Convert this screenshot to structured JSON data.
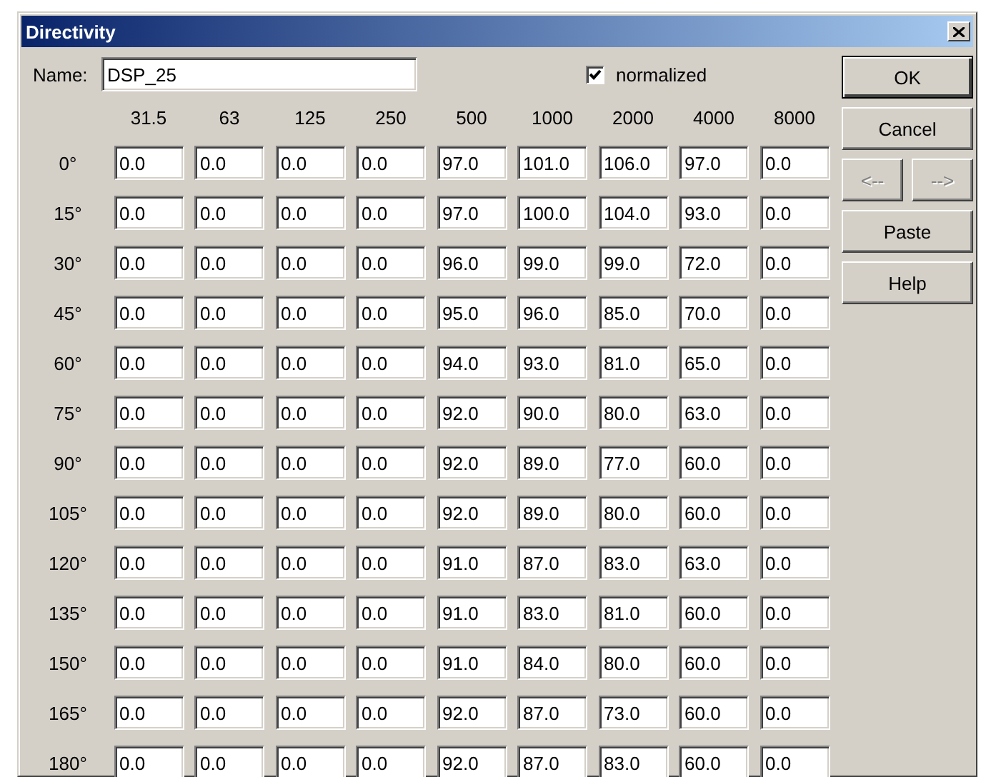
{
  "window": {
    "title": "Directivity"
  },
  "name_field": {
    "label": "Name:",
    "value": "DSP_25"
  },
  "normalized": {
    "label": "normalized",
    "checked": true
  },
  "columns": [
    "31.5",
    "63",
    "125",
    "250",
    "500",
    "1000",
    "2000",
    "4000",
    "8000"
  ],
  "rows": [
    {
      "angle": "0°",
      "values": [
        "0.0",
        "0.0",
        "0.0",
        "0.0",
        "97.0",
        "101.0",
        "106.0",
        "97.0",
        "0.0"
      ]
    },
    {
      "angle": "15°",
      "values": [
        "0.0",
        "0.0",
        "0.0",
        "0.0",
        "97.0",
        "100.0",
        "104.0",
        "93.0",
        "0.0"
      ]
    },
    {
      "angle": "30°",
      "values": [
        "0.0",
        "0.0",
        "0.0",
        "0.0",
        "96.0",
        "99.0",
        "99.0",
        "72.0",
        "0.0"
      ]
    },
    {
      "angle": "45°",
      "values": [
        "0.0",
        "0.0",
        "0.0",
        "0.0",
        "95.0",
        "96.0",
        "85.0",
        "70.0",
        "0.0"
      ]
    },
    {
      "angle": "60°",
      "values": [
        "0.0",
        "0.0",
        "0.0",
        "0.0",
        "94.0",
        "93.0",
        "81.0",
        "65.0",
        "0.0"
      ]
    },
    {
      "angle": "75°",
      "values": [
        "0.0",
        "0.0",
        "0.0",
        "0.0",
        "92.0",
        "90.0",
        "80.0",
        "63.0",
        "0.0"
      ]
    },
    {
      "angle": "90°",
      "values": [
        "0.0",
        "0.0",
        "0.0",
        "0.0",
        "92.0",
        "89.0",
        "77.0",
        "60.0",
        "0.0"
      ]
    },
    {
      "angle": "105°",
      "values": [
        "0.0",
        "0.0",
        "0.0",
        "0.0",
        "92.0",
        "89.0",
        "80.0",
        "60.0",
        "0.0"
      ]
    },
    {
      "angle": "120°",
      "values": [
        "0.0",
        "0.0",
        "0.0",
        "0.0",
        "91.0",
        "87.0",
        "83.0",
        "63.0",
        "0.0"
      ]
    },
    {
      "angle": "135°",
      "values": [
        "0.0",
        "0.0",
        "0.0",
        "0.0",
        "91.0",
        "83.0",
        "81.0",
        "60.0",
        "0.0"
      ]
    },
    {
      "angle": "150°",
      "values": [
        "0.0",
        "0.0",
        "0.0",
        "0.0",
        "91.0",
        "84.0",
        "80.0",
        "60.0",
        "0.0"
      ]
    },
    {
      "angle": "165°",
      "values": [
        "0.0",
        "0.0",
        "0.0",
        "0.0",
        "92.0",
        "87.0",
        "73.0",
        "60.0",
        "0.0"
      ]
    },
    {
      "angle": "180°",
      "values": [
        "0.0",
        "0.0",
        "0.0",
        "0.0",
        "92.0",
        "87.0",
        "83.0",
        "60.0",
        "0.0"
      ]
    }
  ],
  "buttons": [
    {
      "kind": "default",
      "label": "OK",
      "disabled": false
    },
    {
      "kind": "normal",
      "label": "Cancel",
      "disabled": false
    },
    {
      "kind": "pair",
      "items": [
        {
          "label": "<--",
          "disabled": true
        },
        {
          "label": "-->",
          "disabled": true
        }
      ]
    },
    {
      "kind": "normal",
      "label": "Paste",
      "disabled": false
    },
    {
      "kind": "normal",
      "label": "Help",
      "disabled": false
    }
  ]
}
